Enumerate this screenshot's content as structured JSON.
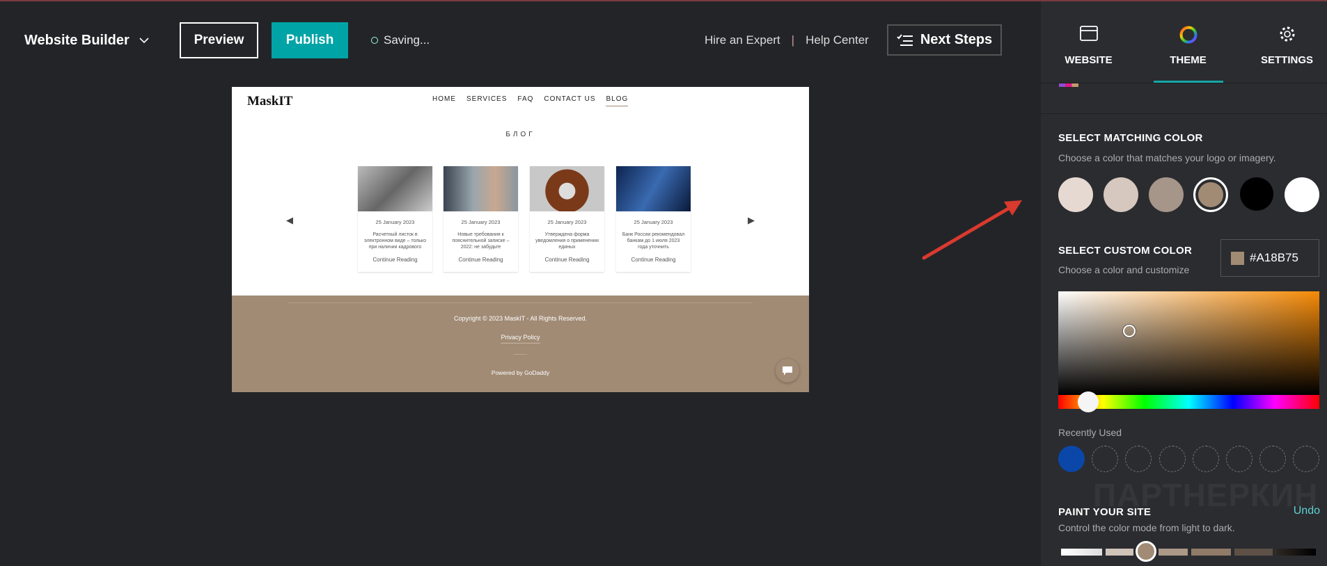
{
  "topbar": {
    "brand": "Website Builder",
    "preview": "Preview",
    "publish": "Publish",
    "status": "Saving...",
    "hire": "Hire an Expert",
    "help": "Help Center",
    "next_steps": "Next Steps",
    "accent": "#00a4a6"
  },
  "site": {
    "logo": "MaskIT",
    "nav": [
      "HOME",
      "SERVICES",
      "FAQ",
      "CONTACT US",
      "BLOG"
    ],
    "active_nav": "BLOG",
    "heading": "БЛОГ",
    "posts": [
      {
        "date": "25 January 2023",
        "title": "Расчетный листок в электронном виде – только при наличии кадрового",
        "link": "Continue Reading"
      },
      {
        "date": "25 January 2023",
        "title": "Новые требования к пояснительной записке – 2022: не забудьте",
        "link": "Continue Reading"
      },
      {
        "date": "25 January 2023",
        "title": "Утверждена форма уведомления о применении единых",
        "link": "Continue Reading"
      },
      {
        "date": "25 January 2023",
        "title": "Банк России рекомендовал банкам до 1 июля 2023 года уточнить",
        "link": "Continue Reading"
      }
    ],
    "footer": {
      "copyright": "Copyright © 2023 MaskIT - All Rights Reserved.",
      "privacy": "Privacy Policy",
      "powered": "Powered by GoDaddy",
      "color": "#a18b75"
    }
  },
  "panel": {
    "tabs": [
      {
        "label": "WEBSITE",
        "icon": "browser-window-icon"
      },
      {
        "label": "THEME",
        "icon": "color-wheel-icon"
      },
      {
        "label": "SETTINGS",
        "icon": "gear-icon"
      }
    ],
    "active_tab": "THEME",
    "matching": {
      "title": "SELECT MATCHING COLOR",
      "subtitle": "Choose a color that matches your logo or imagery.",
      "swatches": [
        "#e6d9d2",
        "#d6c7bf",
        "#a69589",
        "#a18b75",
        "#000000",
        "#ffffff"
      ],
      "selected": 3
    },
    "custom": {
      "title": "SELECT CUSTOM COLOR",
      "subtitle": "Choose a color and customize",
      "hex": "#A18B75"
    },
    "recent": {
      "label": "Recently Used",
      "colors": [
        "#0a47a9"
      ]
    },
    "paint": {
      "title": "PAINT YOUR SITE",
      "undo": "Undo",
      "subtitle": "Control the color mode from light to dark."
    },
    "watermark": "ПАРТНЕРКИН"
  }
}
